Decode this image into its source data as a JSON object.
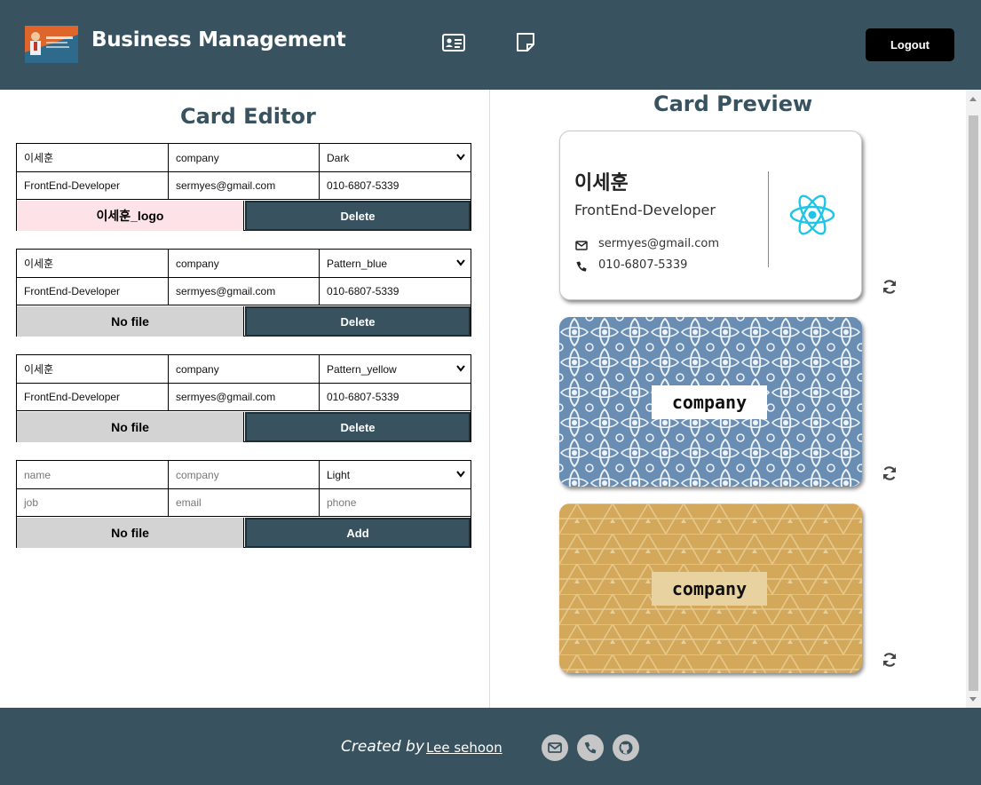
{
  "header": {
    "title": "Business Management",
    "logout_label": "Logout"
  },
  "editor": {
    "title": "Card Editor",
    "cards": [
      {
        "name": "이세훈",
        "company": "company",
        "theme": "Dark",
        "job": "FrontEnd-Developer",
        "email": "sermyes@gmail.com",
        "phone": "010-6807-5339",
        "file_label": "이세훈_logo",
        "action_label": "Delete"
      },
      {
        "name": "이세훈",
        "company": "company",
        "theme": "Pattern_blue",
        "job": "FrontEnd-Developer",
        "email": "sermyes@gmail.com",
        "phone": "010-6807-5339",
        "file_label": "No file",
        "action_label": "Delete"
      },
      {
        "name": "이세훈",
        "company": "company",
        "theme": "Pattern_yellow",
        "job": "FrontEnd-Developer",
        "email": "sermyes@gmail.com",
        "phone": "010-6807-5339",
        "file_label": "No file",
        "action_label": "Delete"
      }
    ],
    "add_form": {
      "name_placeholder": "name",
      "company_placeholder": "company",
      "theme": "Light",
      "job_placeholder": "job",
      "email_placeholder": "email",
      "phone_placeholder": "phone",
      "file_label": "No file",
      "action_label": "Add"
    }
  },
  "preview": {
    "title": "Card Preview",
    "cards": [
      {
        "theme": "light",
        "name": "이세훈",
        "job": "FrontEnd-Developer",
        "email": "sermyes@gmail.com",
        "phone": "010-6807-5339"
      },
      {
        "theme": "pattern-blue",
        "company": "company"
      },
      {
        "theme": "pattern-yellow",
        "company": "company"
      }
    ]
  },
  "footer": {
    "created_by": "Created by",
    "author": "Lee sehoon"
  },
  "colors": {
    "primary": "#38535f",
    "pattern_blue": "#6a8db3",
    "pattern_yellow": "#d4a85a",
    "file_pink": "#fde3e8",
    "react": "#1ec5e8"
  }
}
